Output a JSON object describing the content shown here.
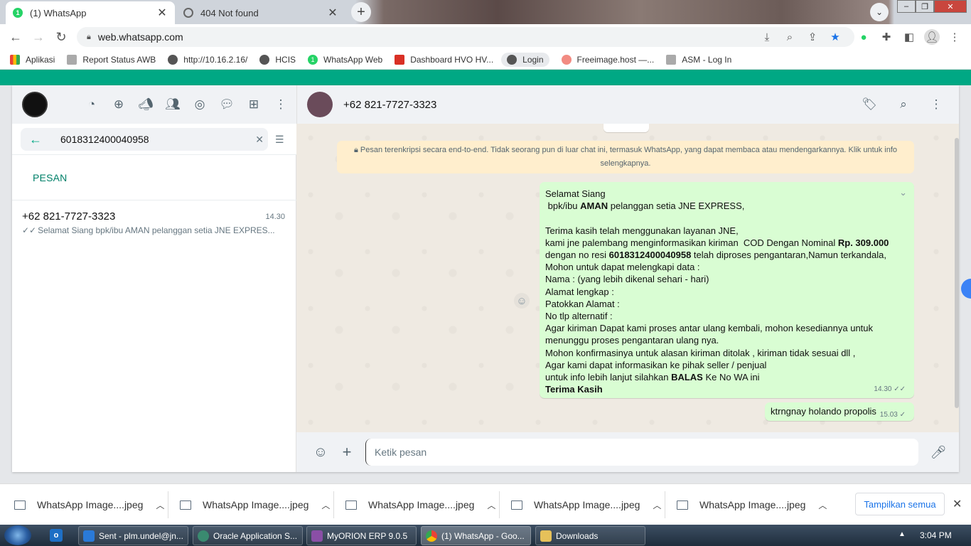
{
  "browser": {
    "tabs": [
      {
        "label": "(1) WhatsApp",
        "active": true,
        "badge": "1"
      },
      {
        "label": "404 Not found",
        "active": false
      }
    ],
    "url": "web.whatsapp.com",
    "bookmarks": [
      "Aplikasi",
      "Report Status AWB",
      "http://10.16.2.16/",
      "HCIS",
      "WhatsApp Web",
      "Dashboard HVO HV...",
      "Login",
      "Freeimage.host —...",
      "ASM - Log In"
    ]
  },
  "sidebar": {
    "search_value": "6018312400040958",
    "section_title": "PESAN",
    "results": [
      {
        "name": "+62 821-7727-3323",
        "time": "14.30",
        "preview": "Selamat Siang   bpk/ibu AMAN pelanggan setia JNE EXPRES..."
      }
    ]
  },
  "chat": {
    "contact": "+62 821-7727-3323",
    "encryption_notice": "Pesan terenkripsi secara end-to-end. Tidak seorang pun di luar chat ini, termasuk WhatsApp, yang dapat membaca atau mendengarkannya. Klik untuk info selengkapnya.",
    "message1": {
      "l01": "Selamat Siang",
      "l02a": " bpk/ibu ",
      "l02b": "AMAN",
      "l02c": " pelanggan setia JNE EXPRESS,",
      "l03": "Terima kasih telah menggunakan layanan JNE,",
      "l04a": "kami jne palembang menginformasikan kiriman  COD Dengan Nominal ",
      "l04b": "Rp. 309.000",
      "l05a": "dengan no resi ",
      "l05b": "6018312400040958",
      "l05c": " telah diproses pengantaran,Namun terkandala,",
      "l06": "Mohon untuk dapat melengkapi data :",
      "l07": "Nama : (yang lebih dikenal sehari - hari)",
      "l08": "Alamat  lengkap :",
      "l09": "Patokkan Alamat :",
      "l10": "No tlp alternatif :",
      "l11": "Agar kiriman Dapat kami proses antar ulang kembali, mohon kesediannya untuk",
      "l12": "menunggu proses pengantaran ulang nya.",
      "l13": "Mohon konfirmasinya untuk alasan kiriman ditolak , kiriman tidak sesuai dll ,",
      "l14": "Agar kami dapat informasikan ke pihak seller / penjual",
      "l15a": "untuk info lebih lanjut silahkan ",
      "l15b": "BALAS",
      "l15c": " Ke No WA ini",
      "l16": "Terima Kasih",
      "time": "14.30"
    },
    "message2": {
      "text": "ktrngnay holando propolis",
      "time": "15.03"
    },
    "composer_placeholder": "Ketik pesan"
  },
  "downloads": {
    "items": [
      "WhatsApp Image....jpeg",
      "WhatsApp Image....jpeg",
      "WhatsApp Image....jpeg",
      "WhatsApp Image....jpeg",
      "WhatsApp Image....jpeg"
    ],
    "show_all": "Tampilkan semua"
  },
  "taskbar": {
    "items": [
      "Sent - plm.undel@jn...",
      "Oracle Application S...",
      "MyORION ERP 9.0.5",
      "(1) WhatsApp - Goo...",
      "Downloads"
    ],
    "clock": "3:04 PM"
  },
  "colors": {
    "wa_green": "#00a884",
    "bubble_out": "#d9fdd3",
    "notice_bg": "#ffeecd"
  }
}
